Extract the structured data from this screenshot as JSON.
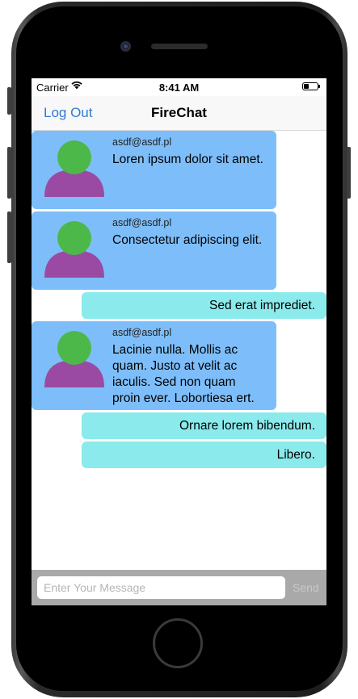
{
  "status_bar": {
    "carrier": "Carrier",
    "time": "8:41 AM"
  },
  "nav": {
    "left_button": "Log Out",
    "title": "FireChat"
  },
  "messages": [
    {
      "type": "incoming",
      "sender": "asdf@asdf.pl",
      "text": "Loren ipsum dolor sit amet."
    },
    {
      "type": "incoming",
      "sender": "asdf@asdf.pl",
      "text": "Consectetur adipiscing elit."
    },
    {
      "type": "outgoing",
      "text": "Sed erat imprediet."
    },
    {
      "type": "incoming",
      "sender": "asdf@asdf.pl",
      "text": "Lacinie nulla. Mollis ac quam. Justo at velit ac iaculis. Sed non quam proin ever. Lobortiesa ert."
    },
    {
      "type": "outgoing",
      "text": "Ornare lorem bibendum."
    },
    {
      "type": "outgoing",
      "text": "Libero."
    }
  ],
  "input": {
    "placeholder": "Enter Your Message",
    "value": "",
    "send_label": "Send"
  },
  "colors": {
    "incoming_bubble": "#7dbefa",
    "outgoing_bubble": "#8beaeb",
    "link": "#2f7bd3",
    "avatar_head": "#4cb84a",
    "avatar_body": "#9b4aa3"
  },
  "icons": [
    "wifi-icon",
    "battery-icon",
    "avatar-icon"
  ]
}
